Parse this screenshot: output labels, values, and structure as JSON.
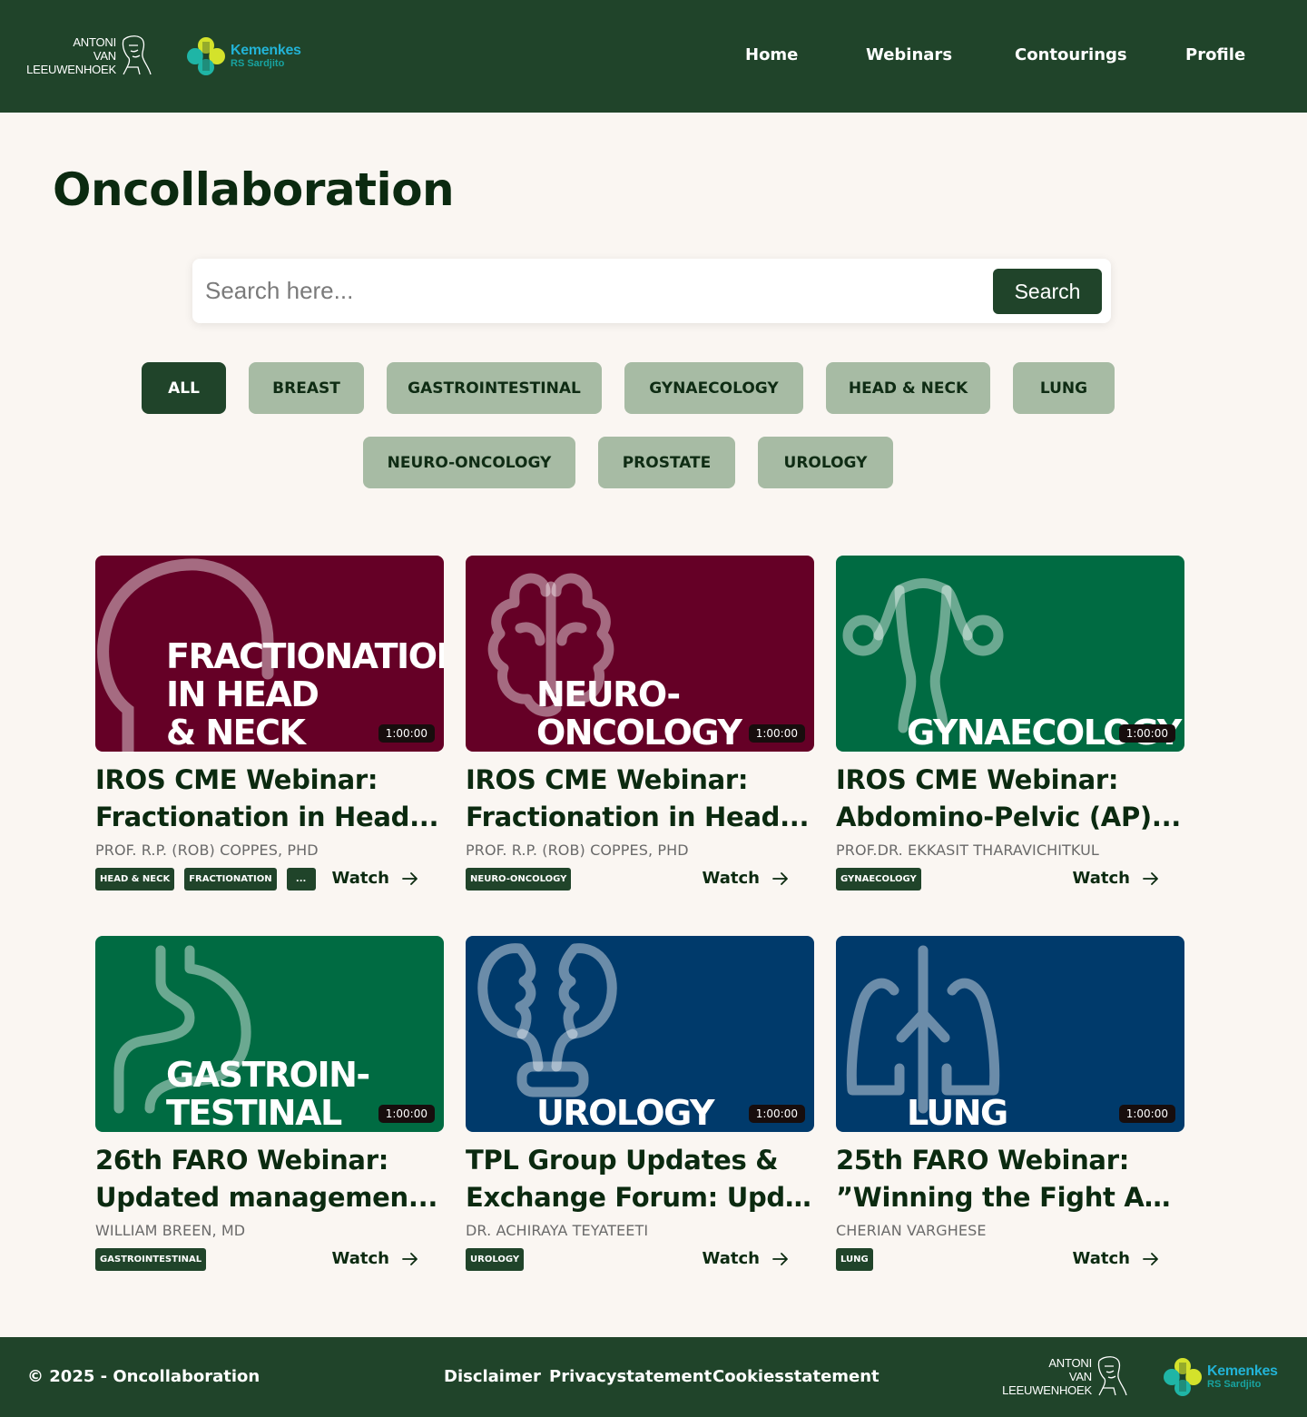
{
  "header": {
    "logo_avl_lines": [
      "ANTONI",
      "VAN",
      "LEEUWENHOEK"
    ],
    "logo_kemenkes": {
      "name": "Kemenkes",
      "sub": "RS Sardjito"
    },
    "nav": [
      "Home",
      "Webinars",
      "Contourings",
      "Profile"
    ]
  },
  "page_title": "Oncollaboration",
  "search": {
    "placeholder": "Search here...",
    "button": "Search"
  },
  "filters": [
    "ALL",
    "BREAST",
    "GASTROINTESTINAL",
    "GYNAECOLOGY",
    "HEAD & NECK",
    "LUNG",
    "NEURO-ONCOLOGY",
    "PROSTATE",
    "UROLOGY"
  ],
  "active_filter": "ALL",
  "colors": {
    "header_bg": "#20442a",
    "page_bg": "#faf6f2",
    "chip_bg": "#a7bba4",
    "maroon": "#650026",
    "green": "#006b42",
    "navy": "#003a6b",
    "kemenkes_blue": "#22b3d6",
    "kemenkes_yellow": "#d4e22b"
  },
  "cards": [
    {
      "thumb_label": "FRACTIONATION\nIN HEAD\n& NECK",
      "thumb_color": "#650026",
      "thumb_icon": "head-profile-icon",
      "duration": "1:00:00",
      "title_lines": [
        "IROS CME Webinar:",
        "Fractionation in Head..."
      ],
      "author": "PROF. R.P. (ROB) COPPES, PHD",
      "tags": [
        "HEAD & NECK",
        "FRACTIONATION",
        "..."
      ],
      "watch": "Watch"
    },
    {
      "thumb_label": "NEURO-\nONCOLOGY",
      "thumb_color": "#650026",
      "thumb_icon": "brain-icon",
      "duration": "1:00:00",
      "title_lines": [
        "IROS CME Webinar:",
        "Fractionation in Head..."
      ],
      "author": "PROF. R.P. (ROB) COPPES, PHD",
      "tags": [
        "NEURO-ONCOLOGY"
      ],
      "watch": "Watch"
    },
    {
      "thumb_label": "GYNAECOLOGY",
      "thumb_color": "#006b42",
      "thumb_icon": "uterus-icon",
      "duration": "1:00:00",
      "title_lines": [
        "IROS CME Webinar:",
        "Abdomino-Pelvic (AP)..."
      ],
      "author": "PROF.DR. EKKASIT THARAVICHITKUL",
      "tags": [
        "GYNAECOLOGY"
      ],
      "watch": "Watch"
    },
    {
      "thumb_label": "GASTROIN-\nTESTINAL",
      "thumb_color": "#006b42",
      "thumb_icon": "stomach-icon",
      "duration": "1:00:00",
      "title_lines": [
        "26th FARO Webinar:",
        "Updated managemen..."
      ],
      "author": "WILLIAM BREEN, MD",
      "tags": [
        "GASTROINTESTINAL"
      ],
      "watch": "Watch"
    },
    {
      "thumb_label": "UROLOGY",
      "thumb_color": "#003a6b",
      "thumb_icon": "kidneys-icon",
      "duration": "1:00:00",
      "title_lines": [
        "TPL Group Updates &",
        "Exchange Forum: Upd..."
      ],
      "author": "DR. ACHIRAYA TEYATEETI",
      "tags": [
        "UROLOGY"
      ],
      "watch": "Watch"
    },
    {
      "thumb_label": "LUNG",
      "thumb_color": "#003a6b",
      "thumb_icon": "lungs-icon",
      "duration": "1:00:00",
      "title_lines": [
        "25th FARO Webinar:",
        "”Winning the Fight Ag..."
      ],
      "author": "CHERIAN VARGHESE",
      "tags": [
        "LUNG"
      ],
      "watch": "Watch"
    }
  ],
  "footer": {
    "copyright": "© 2025 - Oncollaboration",
    "links": [
      "Disclaimer",
      "Privacystatement",
      "Cookiesstatement"
    ]
  }
}
